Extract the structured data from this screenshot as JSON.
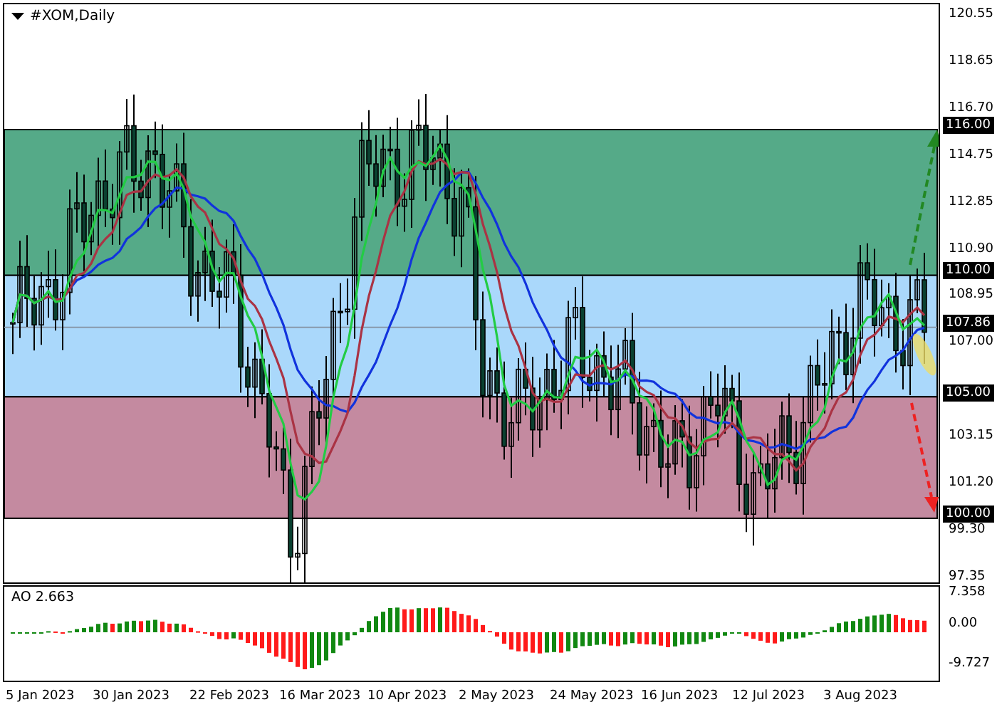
{
  "chart": {
    "title": "#XOM,Daily",
    "price_ticks": [
      "120.55",
      "118.65",
      "116.70",
      "114.75",
      "112.85",
      "110.90",
      "108.95",
      "107.00",
      "103.15",
      "101.20",
      "99.30",
      "97.35"
    ],
    "level_labels": [
      "116.00",
      "110.00",
      "107.86",
      "105.00",
      "100.00"
    ]
  },
  "oscillator": {
    "label": "AO 2.663",
    "ticks": [
      "7.358",
      "0.00",
      "-9.727"
    ]
  },
  "dates": [
    "5 Jan 2023",
    "30 Jan 2023",
    "22 Feb 2023",
    "16 Mar 2023",
    "10 Apr 2023",
    "2 May 2023",
    "24 May 2023",
    "16 Jun 2023",
    "12 Jul 2023",
    "3 Aug 2023"
  ]
}
